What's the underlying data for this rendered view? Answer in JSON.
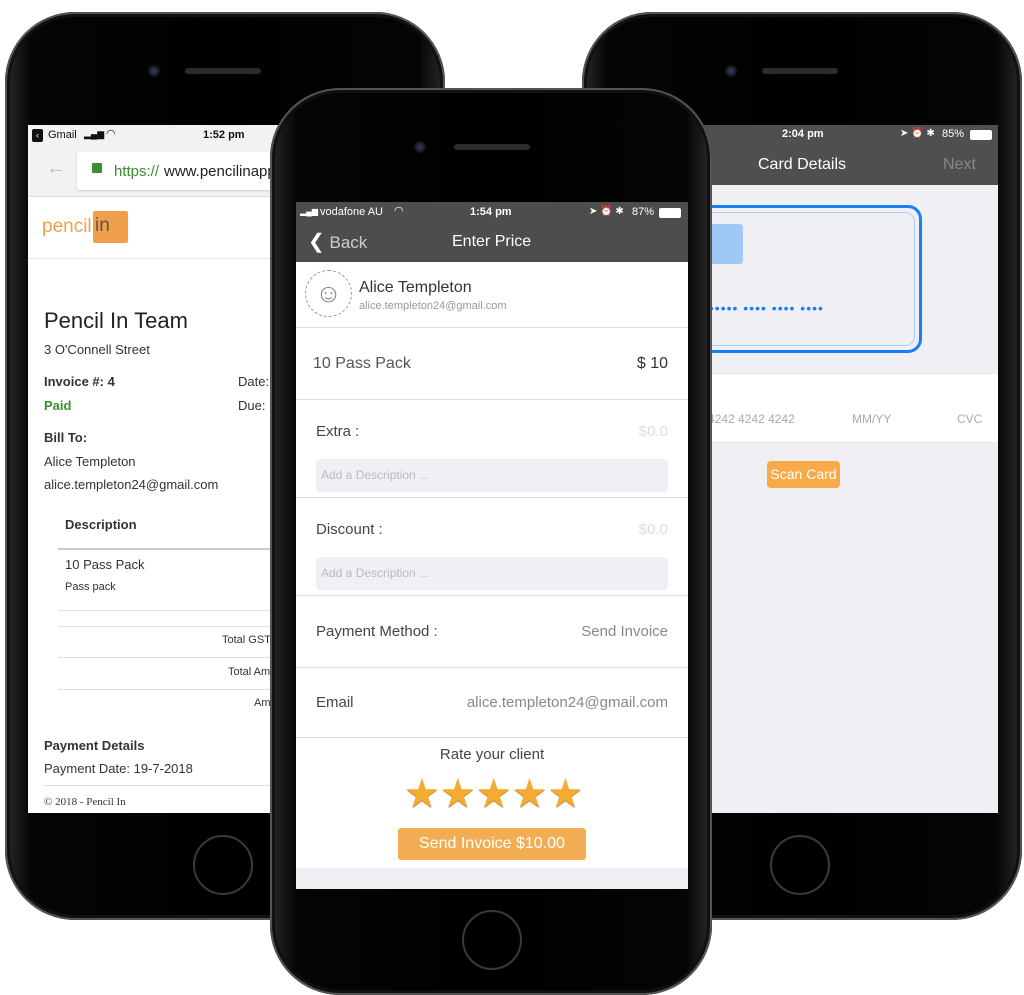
{
  "left_phone": {
    "status": {
      "app": "Gmail",
      "time": "1:52 pm"
    },
    "browser": {
      "url_scheme": "https://",
      "url_rest": "www.pencilinapp"
    },
    "logo": {
      "text_a": "pencil",
      "text_b": "in"
    },
    "invoice": {
      "company": "Pencil In Team",
      "address": "3 O'Connell Street",
      "invoice_no": "Invoice #: 4",
      "status": "Paid",
      "date_label": "Date:",
      "due_label": "Due:",
      "bill_to": "Bill To:",
      "client_name": "Alice Templeton",
      "client_email": "alice.templeton24@gmail.com",
      "col_description": "Description",
      "item_name": "10 Pass Pack",
      "item_desc": "Pass pack",
      "total_gst": "Total GST",
      "total_amount": "Total Am",
      "amount": "Am",
      "payment_details": "Payment Details",
      "payment_date": "Payment Date: 19-7-2018",
      "footer": "© 2018 - Pencil In"
    },
    "colors": {
      "paid": "#3a8f2f",
      "brand": "#f0a04b"
    }
  },
  "middle_phone": {
    "status": {
      "carrier": "vodafone AU",
      "time": "1:54 pm",
      "battery": "87%"
    },
    "nav": {
      "back": "Back",
      "title": "Enter Price"
    },
    "client": {
      "name": "Alice Templeton",
      "email": "alice.templeton24@gmail.com"
    },
    "item": {
      "name": "10 Pass Pack",
      "price": "$ 10"
    },
    "extra": {
      "label": "Extra :",
      "value": "$0.0",
      "placeholder": "Add a Description ..."
    },
    "discount": {
      "label": "Discount :",
      "value": "$0.0",
      "placeholder": "Add a Description ..."
    },
    "payment_method": {
      "label": "Payment Method :",
      "value": "Send Invoice"
    },
    "email": {
      "label": "Email",
      "value": "alice.templeton24@gmail.com"
    },
    "rating": {
      "label": "Rate your client",
      "stars": 5,
      "max": 5
    },
    "send_button": "Send Invoice $10.00",
    "colors": {
      "nav": "#4b4e4d",
      "accent": "#f2ad54"
    }
  },
  "right_phone": {
    "status": {
      "time": "2:04 pm",
      "battery": "85%"
    },
    "nav": {
      "title": "Card Details",
      "next": "Next"
    },
    "card": {
      "number_placeholder": "4242 4242 4242 4242",
      "expiry_placeholder": "MM/YY",
      "cvc_placeholder": "CVC"
    },
    "scan_button": "Scan Card",
    "colors": {
      "card_outline": "#1a7ef5",
      "scan": "#f7aa47"
    }
  }
}
